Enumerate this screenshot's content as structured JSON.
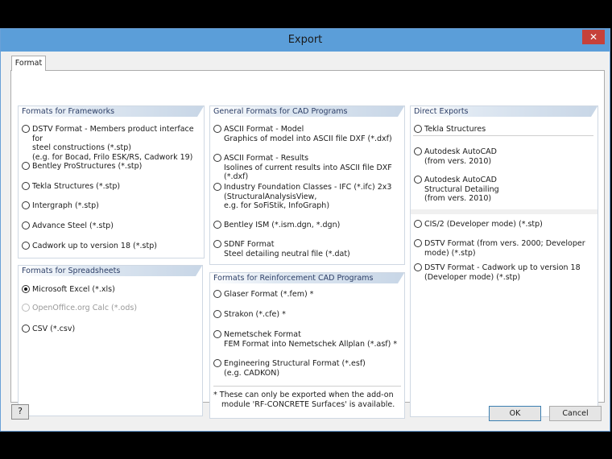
{
  "window": {
    "title": "Export",
    "close": "✕"
  },
  "tab": {
    "label": "Format"
  },
  "frameworks": {
    "header": "Formats for Frameworks",
    "options": [
      {
        "lines": [
          "DSTV Format - Members product interface for",
          "steel constructions (*.stp)",
          "(e.g. for Bocad, Frilo ESK/RS, Cadwork 19)"
        ]
      },
      {
        "lines": [
          "Bentley ProStructures (*.stp)"
        ]
      },
      {
        "lines": [
          "Tekla Structures (*.stp)"
        ]
      },
      {
        "lines": [
          "Intergraph (*.stp)"
        ]
      },
      {
        "lines": [
          "Advance Steel (*.stp)"
        ]
      },
      {
        "lines": [
          "Cadwork up to version 18 (*.stp)"
        ]
      }
    ]
  },
  "spreadsheets": {
    "header": "Formats for Spreadsheets",
    "options": [
      {
        "lines": [
          "Microsoft Excel (*.xls)"
        ],
        "checked": true
      },
      {
        "lines": [
          "OpenOffice.org Calc (*.ods)"
        ],
        "disabled": true
      },
      {
        "lines": [
          "CSV (*.csv)"
        ]
      }
    ]
  },
  "cad": {
    "header": "General Formats for CAD Programs",
    "options": [
      {
        "lines": [
          "ASCII Format - Model",
          "Graphics of model into ASCII file DXF (*.dxf)"
        ]
      },
      {
        "lines": [
          "ASCII Format - Results",
          "Isolines of current results into ASCII file DXF (*.dxf)"
        ]
      },
      {
        "lines": [
          "Industry Foundation Classes - IFC (*.ifc) 2x3",
          "(StructuralAnalysisView,",
          "e.g. for SoFiStik, InfoGraph)"
        ]
      },
      {
        "lines": [
          "Bentley ISM (*.ism.dgn, *.dgn)"
        ]
      },
      {
        "lines": [
          "SDNF Format",
          "Steel detailing neutral file (*.dat)"
        ]
      }
    ]
  },
  "reinforcement": {
    "header": "Formats for Reinforcement CAD Programs",
    "options": [
      {
        "lines": [
          "Glaser Format  (*.fem)  *"
        ]
      },
      {
        "lines": [
          "Strakon (*.cfe)  *"
        ]
      },
      {
        "lines": [
          "Nemetschek Format",
          "FEM Format into Nemetschek Allplan (*.asf)  *"
        ]
      },
      {
        "lines": [
          "Engineering Structural Format (*.esf)",
          "(e.g. CADKON)"
        ]
      }
    ],
    "note": [
      "*  These can only be exported when the add-on",
      "module 'RF-CONCRETE Surfaces' is available."
    ]
  },
  "direct": {
    "header": "Direct Exports",
    "options": [
      {
        "lines": [
          "Tekla Structures"
        ]
      },
      {
        "lines": [
          "Autodesk AutoCAD",
          "(from vers. 2010)"
        ]
      },
      {
        "lines": [
          "Autodesk AutoCAD",
          "Structural Detailing",
          "(from vers. 2010)"
        ]
      }
    ],
    "options2": [
      {
        "lines": [
          "CIS/2 (Developer mode) (*.stp)"
        ]
      },
      {
        "lines": [
          "DSTV Format (from vers. 2000; Developer",
          "mode) (*.stp)"
        ]
      },
      {
        "lines": [
          "DSTV Format - Cadwork up to version 18",
          "(Developer mode) (*.stp)"
        ]
      }
    ]
  },
  "buttons": {
    "help": "?",
    "ok": "OK",
    "cancel": "Cancel"
  }
}
